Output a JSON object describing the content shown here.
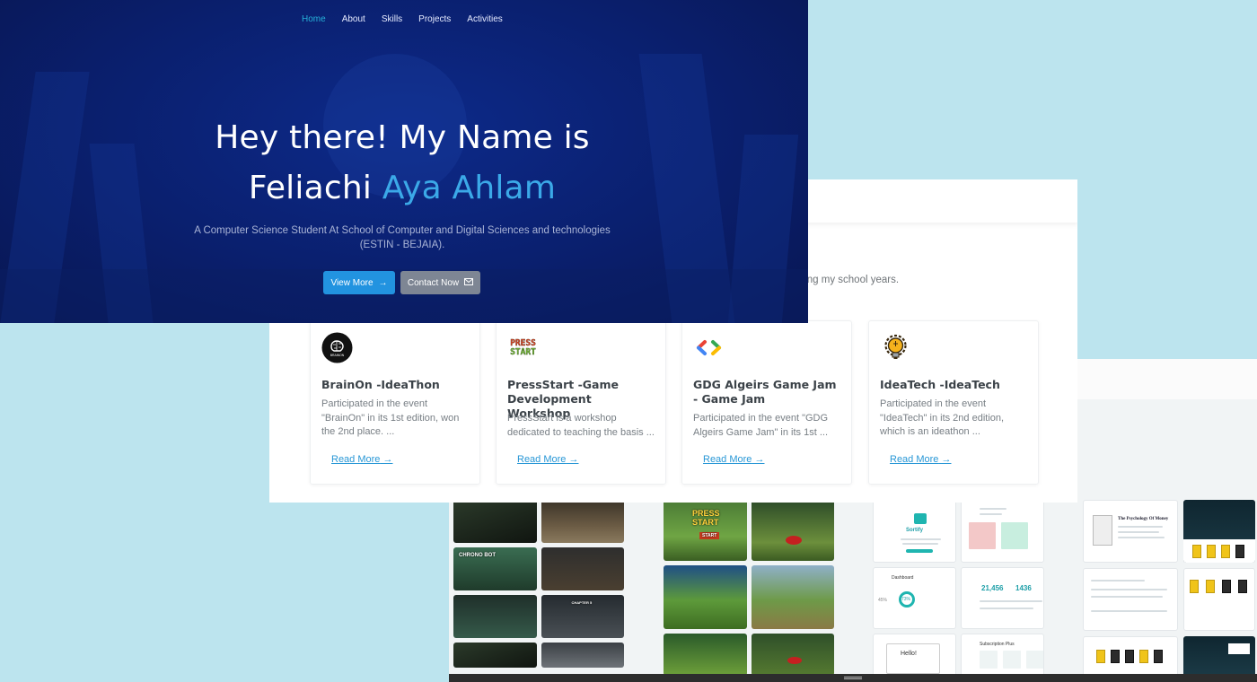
{
  "hero": {
    "nav": [
      {
        "label": "Home",
        "active": true
      },
      {
        "label": "About",
        "active": false
      },
      {
        "label": "Skills",
        "active": false
      },
      {
        "label": "Projects",
        "active": false
      },
      {
        "label": "Activities",
        "active": false
      }
    ],
    "title_prefix": "Hey there! My Name is",
    "title_name_first": "Feliachi",
    "title_name_highlight": "Aya Ahlam",
    "description_line1": "A Computer Science Student At School of Computer and Digital Sciences and technologies",
    "description_line2": "(ESTIN - BEJAIA).",
    "primary_button": "View More",
    "secondary_button": "Contact Now"
  },
  "activities": {
    "subtitle_fragment": "uring my school years.",
    "cards": [
      {
        "title": "BrainOn -IdeaThon",
        "description": "Participated in the event \"BrainOn\" in its 1st edition, won the 2nd place. ...",
        "read_more": "Read More",
        "logo_icon": "brain-icon",
        "logo_text": "BRAINON"
      },
      {
        "title": "PressStart -Game Development Workshop",
        "description": "PressStart is a workshop dedicated to teaching the basis ...",
        "read_more": "Read More",
        "logo_icon": "press-start-logo",
        "logo_text": "PRESS START"
      },
      {
        "title": "GDG Algeirs Game Jam - Game Jam",
        "description": "Participated in the event \"GDG Algeirs Game Jam\" in its 1st ...",
        "read_more": "Read More",
        "logo_icon": "gdg-logo",
        "logo_text": ""
      },
      {
        "title": "IdeaTech -IdeaTech",
        "description": "Participated in the event \"IdeaTech\" in its 2nd edition, which is an ideathon ...",
        "read_more": "Read More",
        "logo_icon": "lightbulb-gear-icon",
        "logo_text": ""
      }
    ]
  },
  "gallery": {
    "projects": [
      {
        "name": "chronobot-screens",
        "tile_labels": [
          "CHRONO BOT",
          "CHAPTER 5"
        ]
      },
      {
        "name": "press-start-game-screens",
        "tile_labels": [
          "PRESS START",
          "START"
        ]
      },
      {
        "name": "sortify-app-screens",
        "tile_labels": [
          "Sortify",
          "Dashboard",
          "Hello!",
          "Subscription Plus"
        ],
        "values": [
          "21,456",
          "1436",
          "45%",
          "73%"
        ]
      },
      {
        "name": "bookstore-app-screens",
        "tile_labels": [
          "The Psychology Of Money",
          "Psychology of Money"
        ]
      }
    ]
  },
  "colors": {
    "page_background": "#bce4ee",
    "hero_background": "#0a1f6d",
    "accent": "#3ba9e8",
    "nav_active": "#26b0d8",
    "link": "#2897d6",
    "primary_button": "#2293e0",
    "secondary_button": "#7e8694"
  }
}
